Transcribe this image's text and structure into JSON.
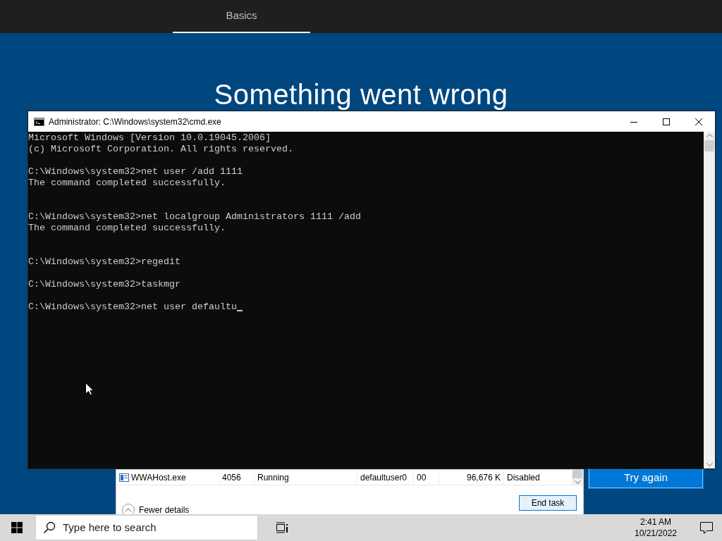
{
  "setup": {
    "tabs": [
      {
        "label": "Basics",
        "selected": true
      }
    ],
    "heading": "Something went wrong",
    "try_again": "Try again"
  },
  "task_manager": {
    "row": {
      "name": "WWAHost.exe",
      "pid": "4056",
      "status": "Running",
      "user": "defaultuser0",
      "cpu": "00",
      "memory": "96,676 K",
      "uac": "Disabled"
    },
    "fewer_details": "Fewer details",
    "end_task": "End task"
  },
  "cmd": {
    "title": "Administrator: C:\\Windows\\system32\\cmd.exe",
    "cursor_visible": true,
    "lines": [
      {
        "kind": "text",
        "text": "Microsoft Windows [Version 10.0.19045.2006]"
      },
      {
        "kind": "text",
        "text": "(c) Microsoft Corporation. All rights reserved."
      },
      {
        "kind": "blank"
      },
      {
        "kind": "text",
        "text": "C:\\Windows\\system32>net user /add 1111"
      },
      {
        "kind": "text",
        "text": "The command completed successfully."
      },
      {
        "kind": "blank"
      },
      {
        "kind": "blank"
      },
      {
        "kind": "text",
        "text": "C:\\Windows\\system32>net localgroup Administrators 1111 /add"
      },
      {
        "kind": "text",
        "text": "The command completed successfully."
      },
      {
        "kind": "blank"
      },
      {
        "kind": "blank"
      },
      {
        "kind": "text",
        "text": "C:\\Windows\\system32>regedit"
      },
      {
        "kind": "blank"
      },
      {
        "kind": "text",
        "text": "C:\\Windows\\system32>taskmgr"
      },
      {
        "kind": "blank"
      },
      {
        "kind": "text",
        "text": "C:\\Windows\\system32>net user defaultu"
      }
    ]
  },
  "taskbar": {
    "search_placeholder": "Type here to search",
    "time": "2:41 AM",
    "date": "10/21/2022"
  }
}
